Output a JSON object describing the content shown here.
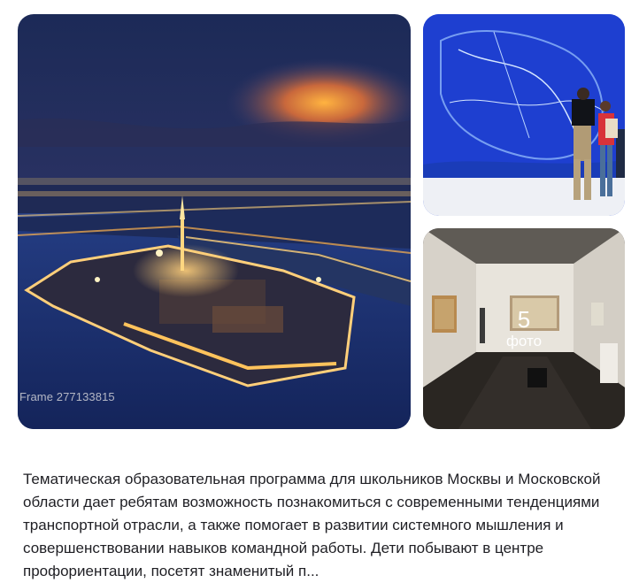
{
  "gallery": {
    "main_photo_alt": "Frame 277133815",
    "more_count": "5",
    "more_label": "фото"
  },
  "description": "Тематическая образовательная программа для школьников Москвы и Московской области дает ребятам возможность познакомиться с современными тенденциями транспортной отрасли, а также помогает в развитии системного мышления и совершенствовании навыков командной работы. Дети побывают в центре профориентации, посетят знаменитый п..."
}
